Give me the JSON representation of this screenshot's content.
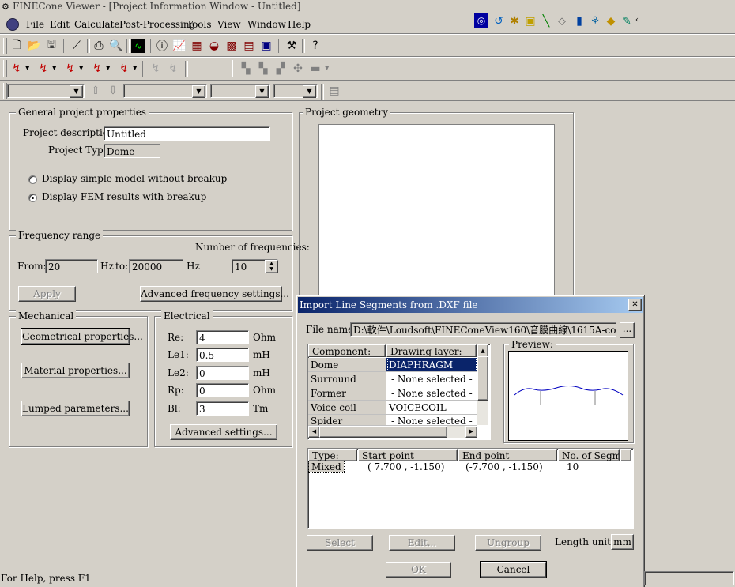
{
  "app": {
    "title": "FINECone Viewer - [Project Information Window - Untitled]"
  },
  "menu": [
    {
      "label": "File"
    },
    {
      "label": "Edit"
    },
    {
      "label": "Calculate"
    },
    {
      "label": "Post-Processing"
    },
    {
      "label": "Tools"
    },
    {
      "label": "View"
    },
    {
      "label": "Window"
    },
    {
      "label": "Help"
    }
  ],
  "general": {
    "group_label": "General project properties",
    "desc_label": "Project description:",
    "desc_value": "Untitled",
    "type_label": "Project Type:",
    "type_value": "Dome",
    "radio_simple": "Display simple model without breakup",
    "radio_fem": "Display FEM results with breakup",
    "selected": "fem"
  },
  "frequency": {
    "group_label": "Frequency range",
    "count_label": "Number of frequencies:",
    "from_label": "From:",
    "from_value": "20",
    "hz1": "Hz",
    "to_label": "to:",
    "to_value": "20000",
    "hz2": "Hz",
    "count_value": "10",
    "apply_button": "Apply",
    "advanced_button": "Advanced frequency settings..."
  },
  "mechanical": {
    "group_label": "Mechanical",
    "geom_button": "Geometrical properties...",
    "material_button": "Material properties...",
    "lumped_button": "Lumped parameters..."
  },
  "electrical": {
    "group_label": "Electrical",
    "rows": [
      {
        "label": "Re:",
        "value": "4",
        "unit": "Ohm"
      },
      {
        "label": "Le1:",
        "value": "0.5",
        "unit": "mH"
      },
      {
        "label": "Le2:",
        "value": "0",
        "unit": "mH"
      },
      {
        "label": "Rp:",
        "value": "0",
        "unit": "Ohm"
      },
      {
        "label": "Bl:",
        "value": "3",
        "unit": "Tm"
      }
    ],
    "advanced_button": "Advanced settings..."
  },
  "geometry": {
    "group_label": "Project geometry"
  },
  "dialog": {
    "title": "Import Line Segments from .DXF file",
    "file_label": "File name:",
    "file_value": "D:\\軟件\\Loudsoft\\FINEConeView160\\音膜曲線\\1615A-copy-2.dxf",
    "browse": "...",
    "col_component": "Component:",
    "col_layer": "Drawing layer:",
    "components": [
      {
        "name": "Dome",
        "layer": "DIAPHRAGM"
      },
      {
        "name": "Surround",
        "layer": "- None selected -"
      },
      {
        "name": "Former",
        "layer": "- None selected -"
      },
      {
        "name": "Voice coil",
        "layer": "VOICECOIL"
      },
      {
        "name": "Spider",
        "layer": "- None selected -"
      }
    ],
    "preview_label": "Preview:",
    "seg_headers": [
      "Type:",
      "Start point",
      "End point",
      "No. of Segm..."
    ],
    "seg_rows": [
      {
        "type": "Mixed",
        "start": "( 7.700 , -1.150)",
        "end": "(-7.700 , -1.150)",
        "count": "10"
      }
    ],
    "select_button": "Select",
    "edit_button": "Edit...",
    "ungroup_button": "Ungroup",
    "length_label": "Length unit:",
    "length_value": "mm",
    "ok_button": "OK",
    "cancel_button": "Cancel",
    "close": "✕"
  },
  "status": {
    "text": "For Help, press F1"
  },
  "colors": {
    "accent": "#0a246a",
    "preview_curve": "#0000c0"
  }
}
